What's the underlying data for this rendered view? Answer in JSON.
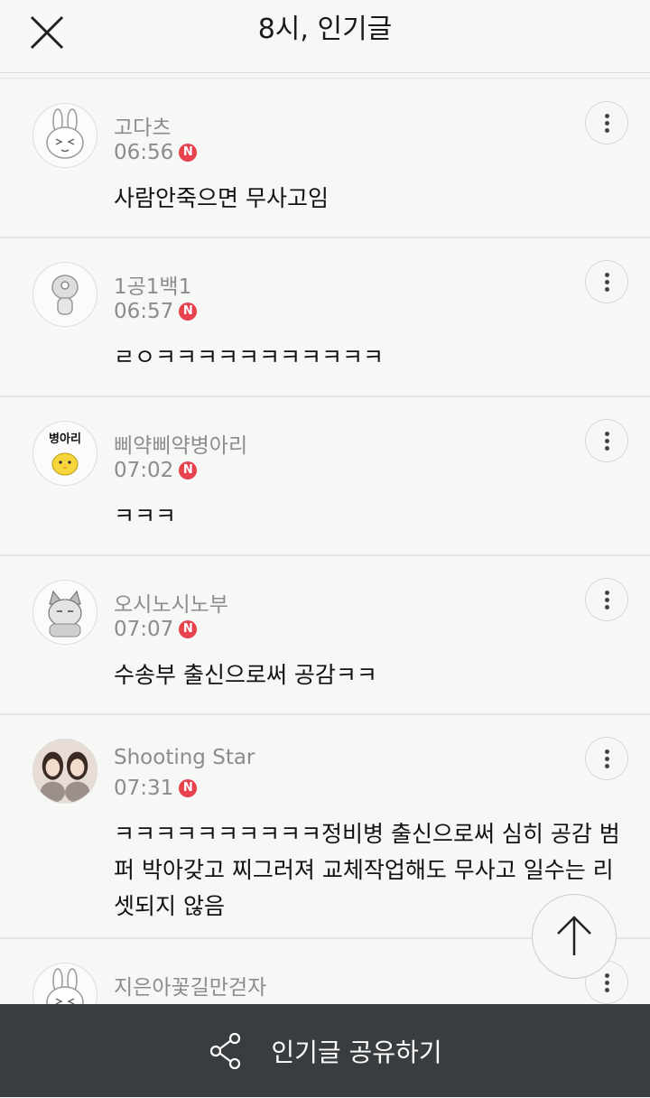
{
  "header": {
    "title": "8시, 인기글",
    "close_icon": "close-icon"
  },
  "comments": [
    {
      "author": "고다츠",
      "time": "06:56",
      "badge": "N",
      "text": "사람안죽으면 무사고임",
      "avatar": "rabbit-avatar"
    },
    {
      "author": "1공1백1",
      "time": "06:57",
      "badge": "N",
      "text": "ㄹㅇㅋㅋㅋㅋㅋㅋㅋㅋㅋㅋㅋ",
      "avatar": "character-avatar"
    },
    {
      "author": "삐약삐약병아리",
      "time": "07:02",
      "badge": "N",
      "text": "ㅋㅋㅋ",
      "avatar": "chick-avatar",
      "avatar_text": "병아리"
    },
    {
      "author": "오시노시노부",
      "time": "07:07",
      "badge": "N",
      "text": "수송부 출신으로써 공감ㅋㅋ",
      "avatar": "cat-avatar"
    },
    {
      "author": "Shooting Star",
      "time": "07:31",
      "badge": "N",
      "text": "ㅋㅋㅋㅋㅋㅋㅋㅋㅋㅋ정비병 출신으로써 심히 공감 범퍼 박아갖고 찌그러져 교체작업해도 무사고 일수는 리셋되지 않음",
      "avatar": "photo-avatar"
    },
    {
      "author": "지은아꽃길만걷자",
      "time": "",
      "badge": "",
      "text": "",
      "avatar": "rabbit-avatar"
    }
  ],
  "scroll_top": {
    "icon": "arrow-up-icon"
  },
  "share_bar": {
    "label": "인기글 공유하기",
    "icon": "share-icon"
  },
  "colors": {
    "badge": "#e8424f",
    "bar": "#3a3d3f",
    "background": "#f6f8f5"
  }
}
